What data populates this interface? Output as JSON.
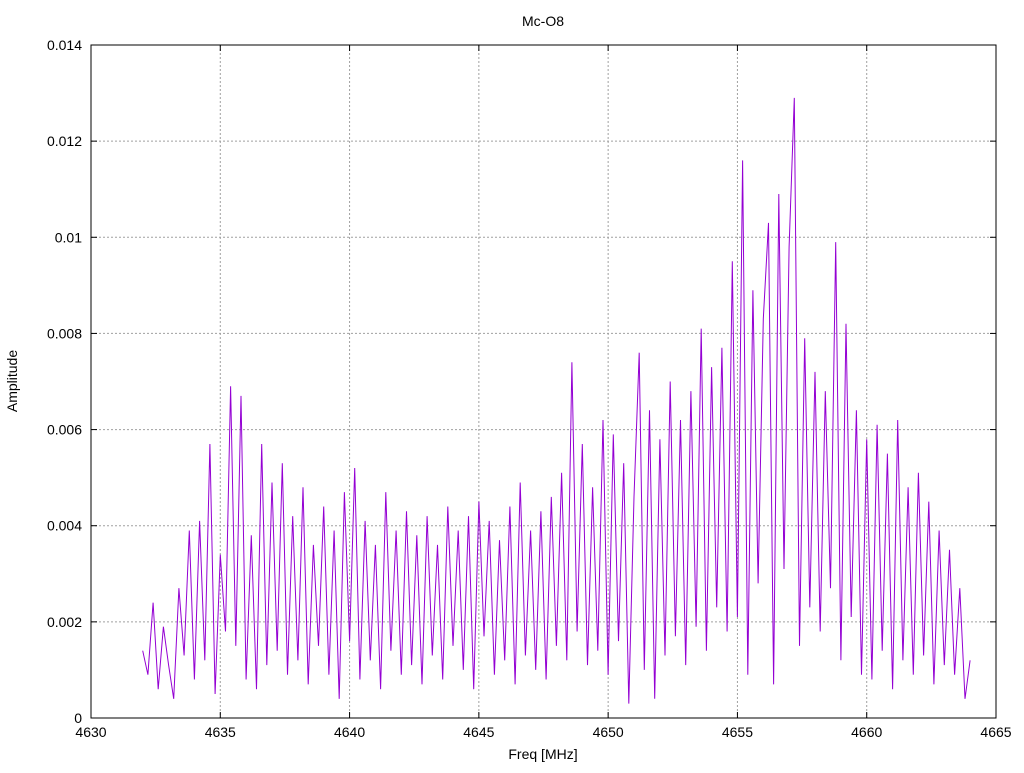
{
  "chart_data": {
    "type": "line",
    "title": "Mc-O8",
    "xlabel": "Freq [MHz]",
    "ylabel": "Amplitude",
    "xlim": [
      4630,
      4665
    ],
    "ylim": [
      0,
      0.014
    ],
    "xticks": [
      "4630",
      "4635",
      "4640",
      "4645",
      "4650",
      "4655",
      "4660",
      "4665"
    ],
    "yticks": [
      "0",
      "0.002",
      "0.004",
      "0.006",
      "0.008",
      "0.01",
      "0.012",
      "0.014"
    ],
    "grid": true,
    "legend": "none",
    "series": [
      {
        "name": "Mc-O8",
        "color": "#9400d3",
        "x_start": 4632.0,
        "x_step": 0.2,
        "values": [
          0.0014,
          0.0009,
          0.0024,
          0.0006,
          0.0019,
          0.0011,
          0.0004,
          0.0027,
          0.0013,
          0.0039,
          0.0008,
          0.0041,
          0.0012,
          0.0057,
          0.0005,
          0.0034,
          0.0018,
          0.0069,
          0.0015,
          0.0067,
          0.0008,
          0.0038,
          0.0006,
          0.0057,
          0.0011,
          0.0049,
          0.0014,
          0.0053,
          0.0009,
          0.0042,
          0.0012,
          0.0048,
          0.0007,
          0.0036,
          0.0015,
          0.0044,
          0.0009,
          0.0039,
          0.0004,
          0.0047,
          0.0016,
          0.0052,
          0.0008,
          0.0041,
          0.0012,
          0.0036,
          0.0006,
          0.0047,
          0.0014,
          0.0039,
          0.0009,
          0.0043,
          0.0011,
          0.0038,
          0.0007,
          0.0042,
          0.0013,
          0.0036,
          0.0008,
          0.0044,
          0.0015,
          0.0039,
          0.001,
          0.0042,
          0.0006,
          0.0045,
          0.0017,
          0.0041,
          0.0009,
          0.0037,
          0.0012,
          0.0044,
          0.0007,
          0.0049,
          0.0013,
          0.0039,
          0.001,
          0.0043,
          0.0008,
          0.0046,
          0.0015,
          0.0051,
          0.0012,
          0.0074,
          0.0018,
          0.0057,
          0.0011,
          0.0048,
          0.0014,
          0.0062,
          0.0009,
          0.0059,
          0.0016,
          0.0053,
          0.0003,
          0.0046,
          0.0076,
          0.001,
          0.0064,
          0.0004,
          0.0058,
          0.0013,
          0.007,
          0.0017,
          0.0062,
          0.0011,
          0.0068,
          0.0019,
          0.0081,
          0.0014,
          0.0073,
          0.0023,
          0.0077,
          0.0018,
          0.0095,
          0.0021,
          0.0116,
          0.0009,
          0.0089,
          0.0028,
          0.0083,
          0.0103,
          0.0007,
          0.0109,
          0.0031,
          0.0098,
          0.0129,
          0.0015,
          0.0079,
          0.0023,
          0.0072,
          0.0018,
          0.0068,
          0.0027,
          0.0099,
          0.0012,
          0.0082,
          0.0021,
          0.0064,
          0.0009,
          0.0058,
          0.0008,
          0.0061,
          0.0014,
          0.0055,
          0.0006,
          0.0062,
          0.0012,
          0.0048,
          0.0009,
          0.0051,
          0.0013,
          0.0045,
          0.0007,
          0.0039,
          0.0011,
          0.0035,
          0.0009,
          0.0027,
          0.0004,
          0.0012
        ]
      }
    ]
  }
}
